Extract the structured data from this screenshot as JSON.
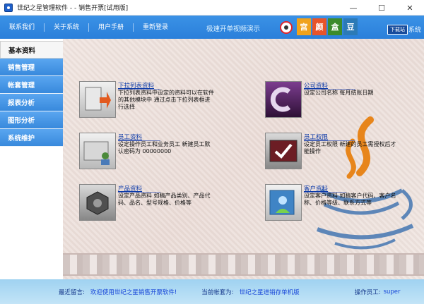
{
  "window": {
    "title": "世纪之星管理软件 - - 销售开票[试用版]",
    "controls": [
      "—",
      "☐",
      "✕"
    ]
  },
  "menu": {
    "items": [
      "联系我们",
      "关于系统",
      "用户手册",
      "重新登录"
    ],
    "promo": "极速开单视频演示",
    "tiles": [
      "宫",
      "颜",
      "盒",
      "豆"
    ],
    "download_badge": "下载站",
    "system_text": "系统"
  },
  "sidebar": {
    "items": [
      {
        "label": "基本资料",
        "active": true
      },
      {
        "label": "销售管理",
        "active": false
      },
      {
        "label": "帐套管理",
        "active": false
      },
      {
        "label": "报表分析",
        "active": false
      },
      {
        "label": "图形分析",
        "active": false
      },
      {
        "label": "系统维护",
        "active": false
      }
    ]
  },
  "cards": [
    {
      "title": "下拉列表资料",
      "desc": [
        "下拉列表资料中设定的资料可以在软件",
        "的其他模块中 通过点击下拉列表框进",
        "行选择"
      ],
      "icon": "folder-download-icon"
    },
    {
      "title": "公司资料",
      "desc": [
        "设定公司名称 每月结账日期"
      ],
      "icon": "company-logo-icon"
    },
    {
      "title": "员工资料",
      "desc": [
        "设定操作员工和业务员工 新建员工默",
        "认密码为 00000000"
      ],
      "icon": "employee-folder-icon"
    },
    {
      "title": "员工权限",
      "desc": [
        "设定员工权限 新建的员工需授权后才",
        "能操作"
      ],
      "icon": "permission-check-icon"
    },
    {
      "title": "产品资料",
      "desc": [
        "设定产品资料 如稿产品类别、产品代",
        "码、品名、型号规格、价格等"
      ],
      "icon": "product-box-icon"
    },
    {
      "title": "客户资料",
      "desc": [
        "设定客户资料 如稿客户代码、客户名",
        "称、价格等级、联系方式等"
      ],
      "icon": "customer-card-icon"
    }
  ],
  "status": {
    "message_label": "最近留言:",
    "message_value": "欢迎使用世纪之星销售开票软件!",
    "account_label": "当前帐套为:",
    "account_value": "世纪之星进销存单机版",
    "operator_label": "操作员工:",
    "operator_value": "super"
  },
  "colors": {
    "menu_blue": "#2a7fda",
    "nav_blue": "#3889dc",
    "link_blue": "#0b39a8",
    "status_bg": "#b1daf4",
    "java_orange": "#e7851b",
    "java_blue": "#5d86b8"
  }
}
